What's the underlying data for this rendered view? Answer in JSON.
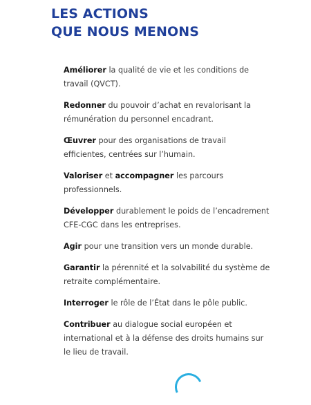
{
  "title": {
    "line1": "LES ACTIONS",
    "line2": "QUE NOUS MENONS"
  },
  "actions": [
    {
      "bold": "Améliorer",
      "rest": " la qualité de vie et les conditions de travail (QVCT)."
    },
    {
      "bold": "Redonner",
      "rest": " du pouvoir d’achat en revalorisant la rémunération du personnel encadrant."
    },
    {
      "bold": "Œuvrer",
      "rest": " pour des organisations de travail efficientes, centrées sur l’humain."
    },
    {
      "bold": "Valoriser",
      "mid": " et ",
      "bold2": "accompagner",
      "rest": " les parcours professionnels."
    },
    {
      "bold": "Développer",
      "rest": " durablement le poids de l’encadrement CFE-CGC dans les entreprises."
    },
    {
      "bold": "Agir",
      "rest": " pour une transition vers un monde durable."
    },
    {
      "bold": "Garantir",
      "rest": " la pérennité et la solvabilité du système de retraite complémentaire."
    },
    {
      "bold": "Interroger",
      "rest": " le rôle de l’État dans le pôle public."
    },
    {
      "bold": "Contribuer",
      "rest": " au dialogue social européen et international et à la défense des droits humains sur le lieu de travail."
    }
  ],
  "colors": {
    "title": "#1f3f9a",
    "body_text": "#3b3b3b",
    "accent_arc": "#29aee0"
  }
}
